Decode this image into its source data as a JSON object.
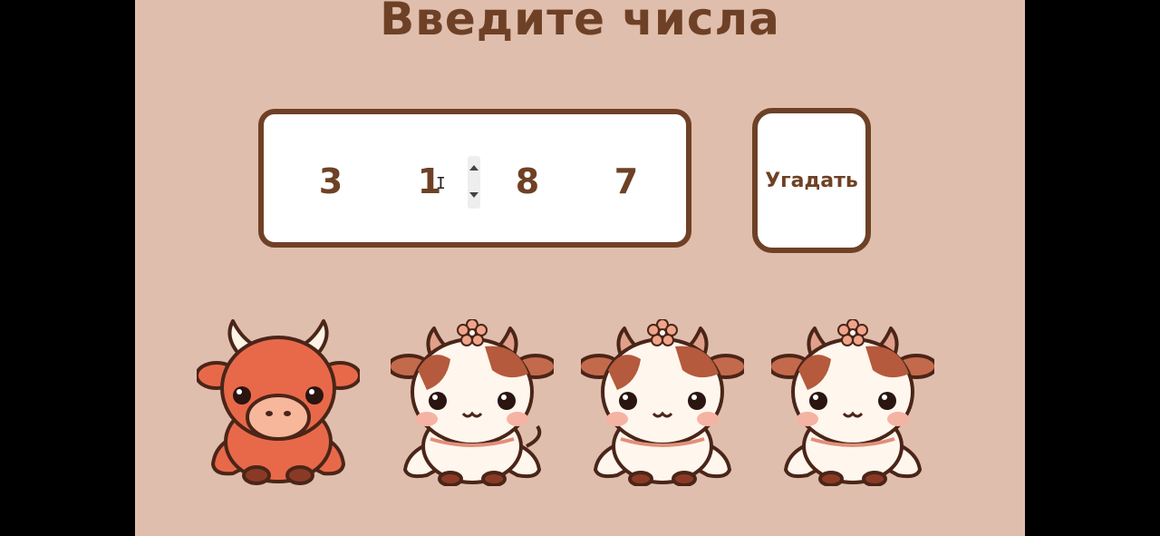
{
  "title": "Введите числа",
  "digits": [
    "3",
    "1",
    "8",
    "7"
  ],
  "guess_button": "Угадать",
  "cows": [
    {
      "icon": "bull-red-icon"
    },
    {
      "icon": "cow-spotted-icon"
    },
    {
      "icon": "cow-spotted-icon"
    },
    {
      "icon": "cow-spotted-icon"
    }
  ],
  "colors": {
    "background": "#e0bead",
    "accent": "#6e4126",
    "bull": "#e8694a",
    "spots": "#b55a3c"
  }
}
